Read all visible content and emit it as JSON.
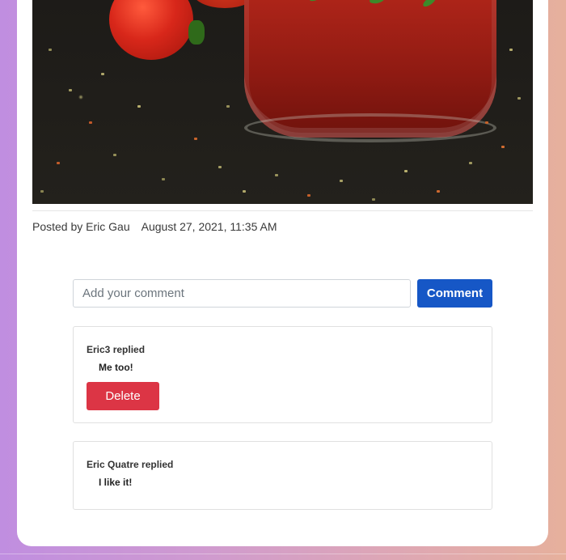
{
  "post": {
    "image_alt": "Tomato sauce jar with basil, tomatoes and herbs",
    "posted_by": "Posted by Eric Gau",
    "timestamp": "August 27, 2021, 11:35 AM"
  },
  "comment_form": {
    "placeholder": "Add your comment",
    "value": "",
    "button_label": "Comment"
  },
  "replies": [
    {
      "author_line": "Eric3 replied",
      "text": "Me too!",
      "delete_label": "Delete"
    },
    {
      "author_line": "Eric Quatre replied",
      "text": "I like it!"
    }
  ],
  "colors": {
    "primary": "#1657c6",
    "danger": "#dc3545",
    "background_start": "#c08ee0",
    "background_end": "#e6b09c"
  }
}
